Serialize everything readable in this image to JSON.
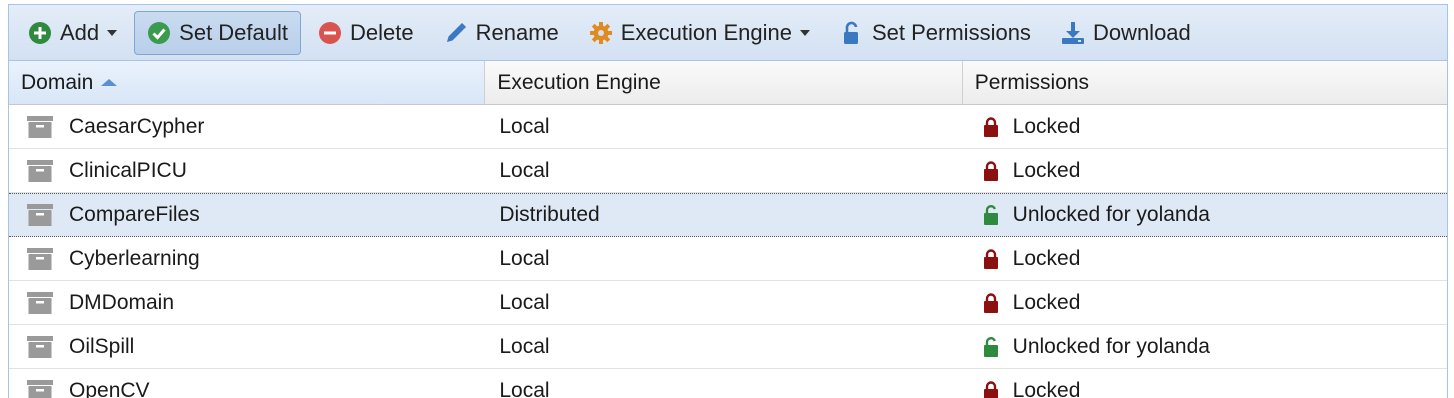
{
  "toolbar": {
    "add_label": "Add",
    "set_default_label": "Set Default",
    "delete_label": "Delete",
    "rename_label": "Rename",
    "execution_engine_label": "Execution Engine",
    "set_permissions_label": "Set Permissions",
    "download_label": "Download"
  },
  "columns": {
    "domain": "Domain",
    "execution_engine": "Execution Engine",
    "permissions": "Permissions"
  },
  "rows": [
    {
      "domain": "CaesarCypher",
      "engine": "Local",
      "permission": "Locked",
      "locked": true,
      "selected": false
    },
    {
      "domain": "ClinicalPICU",
      "engine": "Local",
      "permission": "Locked",
      "locked": true,
      "selected": false
    },
    {
      "domain": "CompareFiles",
      "engine": "Distributed",
      "permission": "Unlocked for yolanda",
      "locked": false,
      "selected": true
    },
    {
      "domain": "Cyberlearning",
      "engine": "Local",
      "permission": "Locked",
      "locked": true,
      "selected": false
    },
    {
      "domain": "DMDomain",
      "engine": "Local",
      "permission": "Locked",
      "locked": true,
      "selected": false
    },
    {
      "domain": "OilSpill",
      "engine": "Local",
      "permission": "Unlocked for yolanda",
      "locked": false,
      "selected": false
    },
    {
      "domain": "OpenCV",
      "engine": "Local",
      "permission": "Locked",
      "locked": true,
      "selected": false
    }
  ],
  "colors": {
    "locked": "#8b1010",
    "unlocked": "#2e8a3c",
    "add_green": "#2f8a3f",
    "check_green": "#3a9a4e",
    "delete_red": "#d9534f",
    "gear_orange": "#e08a22",
    "blue_icon": "#3a78c2",
    "selected_row": "#dfe9f6"
  }
}
